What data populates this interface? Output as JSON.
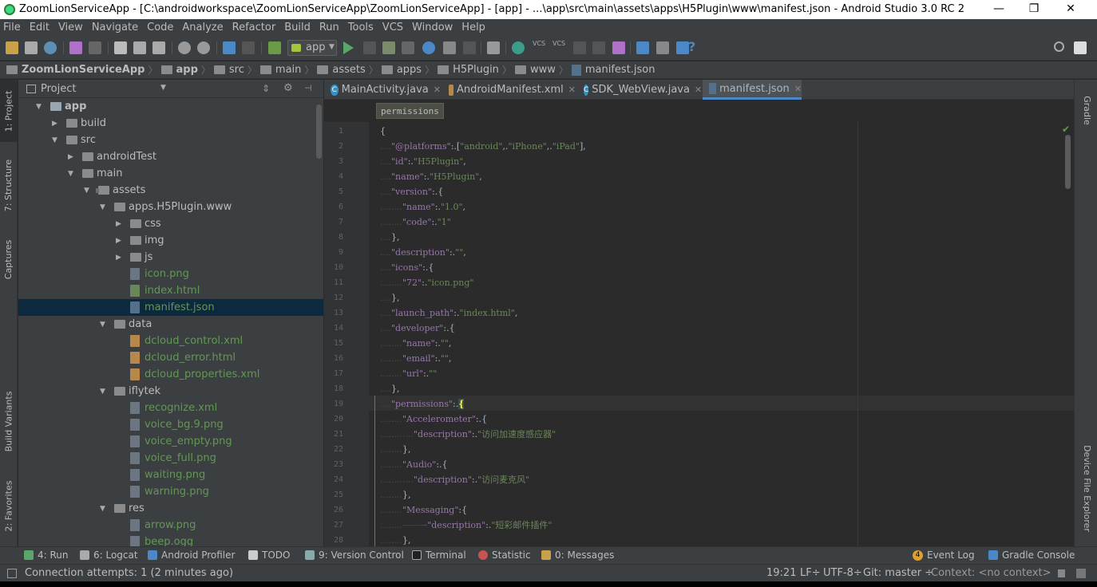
{
  "window": {
    "title": "ZoomLionServiceApp - [C:\\androidworkspace\\ZoomLionServiceApp\\ZoomLionServiceApp] - [app] - ...\\app\\src\\main\\assets\\apps\\H5Plugin\\www\\manifest.json - Android Studio 3.0 RC 2",
    "minimize": "—",
    "restore": "❐",
    "close": "✕"
  },
  "menu": [
    "File",
    "Edit",
    "View",
    "Navigate",
    "Code",
    "Analyze",
    "Refactor",
    "Build",
    "Run",
    "Tools",
    "VCS",
    "Window",
    "Help"
  ],
  "toolbar": {
    "run_config": "app",
    "vcs1": "VCS",
    "vcs2": "VCS",
    "help": "?"
  },
  "nav": [
    "ZoomLionServiceApp",
    "app",
    "src",
    "main",
    "assets",
    "apps",
    "H5Plugin",
    "www",
    "manifest.json"
  ],
  "left_tabs": [
    "1: Project",
    "7: Structure",
    "Captures",
    "Build Variants",
    "2: Favorites"
  ],
  "right_tabs": [
    "Gradle",
    "Device File Explorer"
  ],
  "project": {
    "header": "Project",
    "tree": [
      {
        "label": "app",
        "depth": 1,
        "arrow": "down",
        "type": "module"
      },
      {
        "label": "build",
        "depth": 2,
        "arrow": "right",
        "type": "folder"
      },
      {
        "label": "src",
        "depth": 2,
        "arrow": "down",
        "type": "folder"
      },
      {
        "label": "androidTest",
        "depth": 3,
        "arrow": "right",
        "type": "folder"
      },
      {
        "label": "main",
        "depth": 3,
        "arrow": "down",
        "type": "folder"
      },
      {
        "label": "assets",
        "depth": 4,
        "arrow": "down",
        "type": "pkg"
      },
      {
        "label": "apps.H5Plugin.www",
        "depth": 5,
        "arrow": "down",
        "type": "folder"
      },
      {
        "label": "css",
        "depth": 6,
        "arrow": "right",
        "type": "folder"
      },
      {
        "label": "img",
        "depth": 6,
        "arrow": "right",
        "type": "folder"
      },
      {
        "label": "js",
        "depth": 6,
        "arrow": "right",
        "type": "folder"
      },
      {
        "label": "icon.png",
        "depth": 6,
        "arrow": "none",
        "type": "file"
      },
      {
        "label": "index.html",
        "depth": 6,
        "arrow": "none",
        "type": "html"
      },
      {
        "label": "manifest.json",
        "depth": 6,
        "arrow": "none",
        "type": "json",
        "selected": true
      },
      {
        "label": "data",
        "depth": 5,
        "arrow": "down",
        "type": "folder"
      },
      {
        "label": "dcloud_control.xml",
        "depth": 6,
        "arrow": "none",
        "type": "xml"
      },
      {
        "label": "dcloud_error.html",
        "depth": 6,
        "arrow": "none",
        "type": "xml"
      },
      {
        "label": "dcloud_properties.xml",
        "depth": 6,
        "arrow": "none",
        "type": "xml"
      },
      {
        "label": "iflytek",
        "depth": 5,
        "arrow": "down",
        "type": "folder"
      },
      {
        "label": "recognize.xml",
        "depth": 6,
        "arrow": "none",
        "type": "file"
      },
      {
        "label": "voice_bg.9.png",
        "depth": 6,
        "arrow": "none",
        "type": "file"
      },
      {
        "label": "voice_empty.png",
        "depth": 6,
        "arrow": "none",
        "type": "file"
      },
      {
        "label": "voice_full.png",
        "depth": 6,
        "arrow": "none",
        "type": "file"
      },
      {
        "label": "waiting.png",
        "depth": 6,
        "arrow": "none",
        "type": "file"
      },
      {
        "label": "warning.png",
        "depth": 6,
        "arrow": "none",
        "type": "file"
      },
      {
        "label": "res",
        "depth": 5,
        "arrow": "down",
        "type": "folder"
      },
      {
        "label": "arrow.png",
        "depth": 6,
        "arrow": "none",
        "type": "file"
      },
      {
        "label": "beep.ogg",
        "depth": 6,
        "arrow": "none",
        "type": "file"
      }
    ]
  },
  "tabs": [
    {
      "label": "MainActivity.java",
      "icon": "class"
    },
    {
      "label": "AndroidManifest.xml",
      "icon": "manifest"
    },
    {
      "label": "SDK_WebView.java",
      "icon": "class"
    },
    {
      "label": "manifest.json",
      "icon": "json",
      "active": true
    }
  ],
  "breadcrumb": "permissions",
  "code": [
    [
      [
        "b",
        "{"
      ]
    ],
    [
      [
        "ws",
        "...."
      ],
      [
        "k",
        "\"@platforms\""
      ],
      [
        "b",
        ":."
      ],
      [
        "b",
        "["
      ],
      [
        "s",
        "\"android\""
      ],
      [
        "b",
        ",."
      ],
      [
        "s",
        "\"iPhone\""
      ],
      [
        "b",
        ",."
      ],
      [
        "s",
        "\"iPad\""
      ],
      [
        "b",
        "],"
      ]
    ],
    [
      [
        "ws",
        "...."
      ],
      [
        "k",
        "\"id\""
      ],
      [
        "b",
        ":."
      ],
      [
        "s",
        "\"H5Plugin\""
      ],
      [
        "b",
        ","
      ]
    ],
    [
      [
        "ws",
        "...."
      ],
      [
        "k",
        "\"name\""
      ],
      [
        "b",
        ":."
      ],
      [
        "s",
        "\"H5Plugin\""
      ],
      [
        "b",
        ","
      ]
    ],
    [
      [
        "ws",
        "...."
      ],
      [
        "k",
        "\"version\""
      ],
      [
        "b",
        ":."
      ],
      [
        "b",
        "{"
      ]
    ],
    [
      [
        "ws",
        "........"
      ],
      [
        "k",
        "\"name\""
      ],
      [
        "b",
        ":."
      ],
      [
        "s",
        "\"1.0\""
      ],
      [
        "b",
        ","
      ]
    ],
    [
      [
        "ws",
        "........"
      ],
      [
        "k",
        "\"code\""
      ],
      [
        "b",
        ":."
      ],
      [
        "s",
        "\"1\""
      ]
    ],
    [
      [
        "ws",
        "...."
      ],
      [
        "b",
        "},"
      ]
    ],
    [
      [
        "ws",
        "...."
      ],
      [
        "k",
        "\"description\""
      ],
      [
        "b",
        ":."
      ],
      [
        "s",
        "\"\""
      ],
      [
        "b",
        ","
      ]
    ],
    [
      [
        "ws",
        "...."
      ],
      [
        "k",
        "\"icons\""
      ],
      [
        "b",
        ":."
      ],
      [
        "b",
        "{"
      ]
    ],
    [
      [
        "ws",
        "........"
      ],
      [
        "k",
        "\"72\""
      ],
      [
        "b",
        ":."
      ],
      [
        "s",
        "\"icon.png\""
      ]
    ],
    [
      [
        "ws",
        "...."
      ],
      [
        "b",
        "},"
      ]
    ],
    [
      [
        "ws",
        "...."
      ],
      [
        "k",
        "\"launch_path\""
      ],
      [
        "b",
        ":."
      ],
      [
        "s",
        "\"index.html\""
      ],
      [
        "b",
        ","
      ]
    ],
    [
      [
        "ws",
        "...."
      ],
      [
        "k",
        "\"developer\""
      ],
      [
        "b",
        ":."
      ],
      [
        "b",
        "{"
      ]
    ],
    [
      [
        "ws",
        "........"
      ],
      [
        "k",
        "\"name\""
      ],
      [
        "b",
        ":."
      ],
      [
        "s",
        "\"\""
      ],
      [
        "b",
        ","
      ]
    ],
    [
      [
        "ws",
        "........"
      ],
      [
        "k",
        "\"email\""
      ],
      [
        "b",
        ":."
      ],
      [
        "s",
        "\"\""
      ],
      [
        "b",
        ","
      ]
    ],
    [
      [
        "ws",
        "........"
      ],
      [
        "k",
        "\"url\""
      ],
      [
        "b",
        ":."
      ],
      [
        "s",
        "\"\""
      ]
    ],
    [
      [
        "ws",
        "...."
      ],
      [
        "b",
        "},"
      ]
    ],
    [
      [
        "ws",
        "...."
      ],
      [
        "k",
        "\"permissions\""
      ],
      [
        "b",
        ":."
      ],
      [
        "hl",
        "{"
      ]
    ],
    [
      [
        "ws",
        "........"
      ],
      [
        "k",
        "\"Accelerometer\""
      ],
      [
        "b",
        ":."
      ],
      [
        "b",
        "{"
      ]
    ],
    [
      [
        "ws",
        "............"
      ],
      [
        "k",
        "\"description\""
      ],
      [
        "b",
        ":."
      ],
      [
        "s",
        "\"访问加速度感应器\""
      ]
    ],
    [
      [
        "ws",
        "........"
      ],
      [
        "b",
        "},"
      ]
    ],
    [
      [
        "ws",
        "........"
      ],
      [
        "k",
        "\"Audio\""
      ],
      [
        "b",
        ":."
      ],
      [
        "b",
        "{"
      ]
    ],
    [
      [
        "ws",
        "............"
      ],
      [
        "k",
        "\"description\""
      ],
      [
        "b",
        ":."
      ],
      [
        "s",
        "\"访问麦克风\""
      ]
    ],
    [
      [
        "ws",
        "........"
      ],
      [
        "b",
        "},"
      ]
    ],
    [
      [
        "ws",
        "........"
      ],
      [
        "k",
        "\"Messaging\""
      ],
      [
        "b",
        ":"
      ],
      [
        "b",
        "{"
      ]
    ],
    [
      [
        "ws",
        "........——→"
      ],
      [
        "k",
        "\"description\""
      ],
      [
        "b",
        ":."
      ],
      [
        "s",
        "\"短彩邮件插件\""
      ]
    ],
    [
      [
        "ws",
        "........"
      ],
      [
        "b",
        "},"
      ]
    ]
  ],
  "bottom_tabs": [
    "4: Run",
    "6: Logcat",
    "Android Profiler",
    "TODO",
    "9: Version Control",
    "Terminal",
    "Statistic",
    "0: Messages",
    "Event Log",
    "Gradle Console"
  ],
  "event_log_count": "4",
  "status": {
    "message": "Connection attempts: 1 (2 minutes ago)",
    "position": "19:21",
    "line_sep": "LF÷",
    "encoding": "UTF-8÷",
    "git": "Git: master ÷",
    "context": "Context: <no context>"
  }
}
